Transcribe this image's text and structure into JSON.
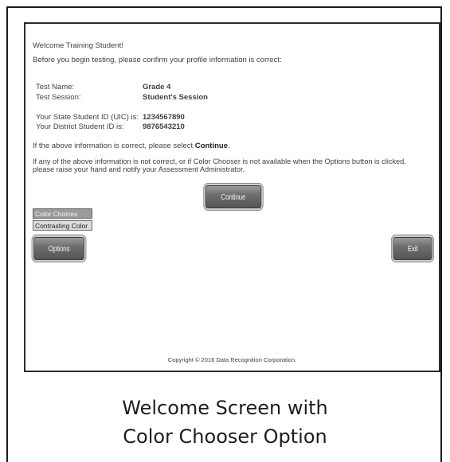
{
  "welcome": {
    "greeting": "Welcome Training Student!",
    "instruction": "Before you begin testing, please confirm your profile information is correct:"
  },
  "profile": {
    "test_name_label": "Test Name:",
    "test_name_value": "Grade 4",
    "test_session_label": "Test Session:",
    "test_session_value": "Student's Session",
    "state_id_label": "Your State Student ID (UIC) is:",
    "state_id_value": "1234567890",
    "district_id_label": "Your District Student ID is:",
    "district_id_value": "9876543210"
  },
  "confirm": {
    "prefix": "If the above information is correct, please select ",
    "keyword": "Continue",
    "suffix": "."
  },
  "notice": {
    "line1": "If any of the above information is not correct, or if Color Chooser is not available when the Options button is clicked,",
    "line2": "please raise your hand and notify your Assessment Administrator."
  },
  "buttons": {
    "continue": "Continue",
    "options": "Options",
    "exit": "Exit"
  },
  "color_menu": {
    "item1": "Color Choices",
    "item2": "Contrasting Color"
  },
  "footer": {
    "copyright": "Copyright © 2016 Data Recognition Corporation."
  },
  "caption": {
    "line1": "Welcome Screen with",
    "line2": "Color Chooser Option"
  }
}
